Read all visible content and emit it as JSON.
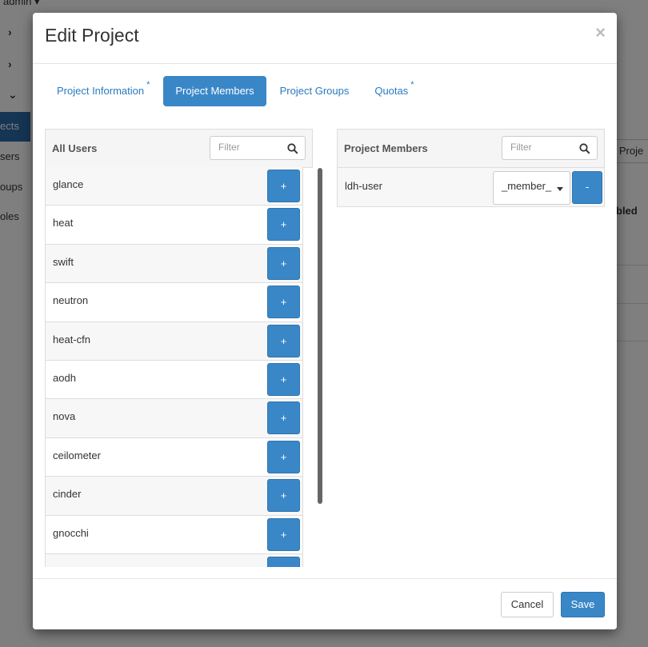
{
  "background": {
    "user_menu": "admin ▾",
    "sidebar": {
      "chevrons": [
        "›",
        "›",
        "⌄"
      ],
      "active_item": "ects",
      "items": [
        "sers",
        "oups",
        "oles"
      ]
    },
    "right_button": "e Proje",
    "right_heading": "bled"
  },
  "modal": {
    "title": "Edit Project",
    "close": "×",
    "tabs": [
      {
        "label": "Project Information",
        "required": "*",
        "active": false
      },
      {
        "label": "Project Members",
        "required": "",
        "active": true
      },
      {
        "label": "Project Groups",
        "required": "",
        "active": false
      },
      {
        "label": "Quotas",
        "required": "*",
        "active": false
      }
    ],
    "all_users": {
      "title": "All Users",
      "filter_placeholder": "Filter",
      "add_label": "+",
      "users": [
        "glance",
        "heat",
        "swift",
        "neutron",
        "heat-cfn",
        "aodh",
        "nova",
        "ceilometer",
        "cinder",
        "gnocchi",
        ""
      ]
    },
    "project_members": {
      "title": "Project Members",
      "filter_placeholder": "Filter",
      "members": [
        {
          "name": "ldh-user",
          "role": "_member_",
          "remove_label": "-"
        }
      ]
    },
    "footer": {
      "cancel_label": "Cancel",
      "save_label": "Save"
    }
  },
  "colors": {
    "primary": "#3a87c8",
    "link": "#2a7ac0",
    "overlay": "rgba(0,0,0,0.5)"
  }
}
